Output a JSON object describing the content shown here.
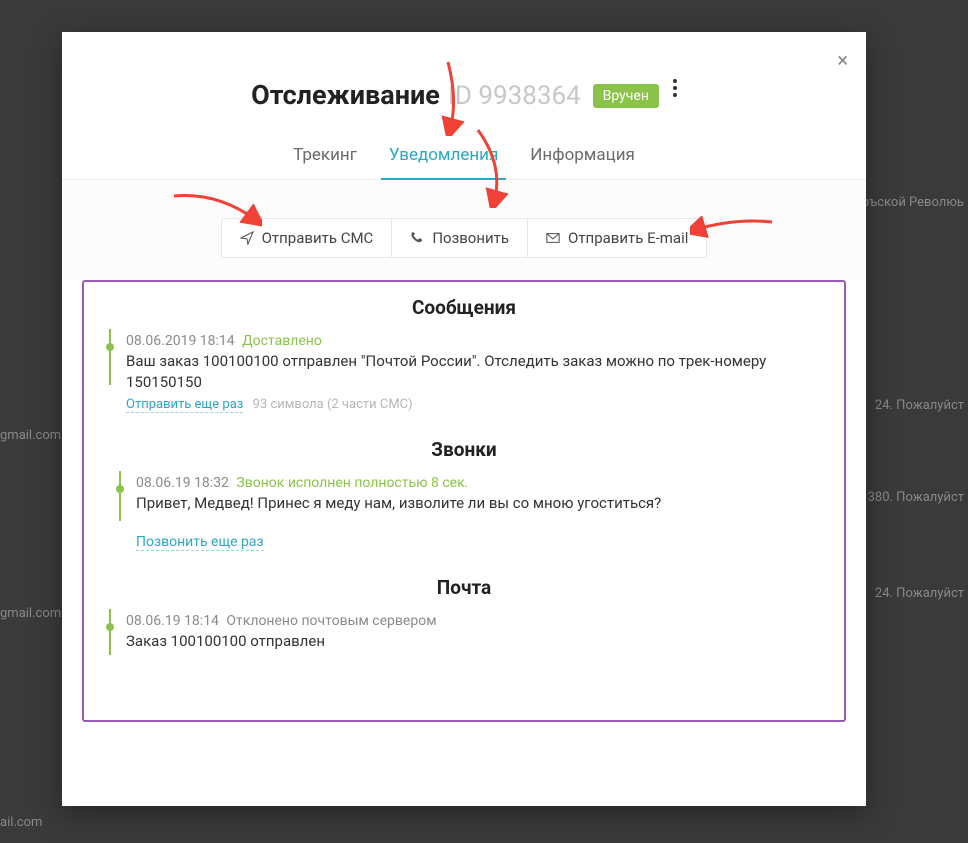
{
  "header": {
    "title": "Отслеживание",
    "id": "ID 9938364",
    "status": "Вручен"
  },
  "tabs": {
    "tracking": "Трекинг",
    "notifications": "Уведомления",
    "info": "Информация"
  },
  "actions": {
    "send_sms": "Отправить СМС",
    "call": "Позвонить",
    "send_email": "Отправить E-mail"
  },
  "sections": {
    "messages_title": "Сообщения",
    "calls_title": "Звонки",
    "mail_title": "Почта"
  },
  "messages": {
    "ts": "08.06.2019 18:14",
    "status": "Доставлено",
    "body": "Ваш заказ 100100100 отправлен \"Почтой России\". Отследить заказ можно по трек-номеру 150150150",
    "resend": "Отправить еще раз",
    "stats": "93 символа (2 части СМС)"
  },
  "calls": {
    "ts": "08.06.19 18:32",
    "status": "Звонок исполнен полностью 8 сек.",
    "body": "Привет, Медвед! Принес я меду нам, изволите ли вы со мною угоститься?",
    "redial": "Позвонить еще раз"
  },
  "mail": {
    "ts": "08.06.19 18:14",
    "status": "Отклонено почтовым сервером",
    "body": "Заказ 100100100 отправлен"
  },
  "background": {
    "frag1": "бръской Революь",
    "frag2": "24. Пожалуйст",
    "frag3": "gmail.com",
    "frag4": "380. Пожалуйст",
    "frag5": "24. Пожалуйст",
    "frag6": "gmail.com",
    "frag7": "ail.com"
  }
}
